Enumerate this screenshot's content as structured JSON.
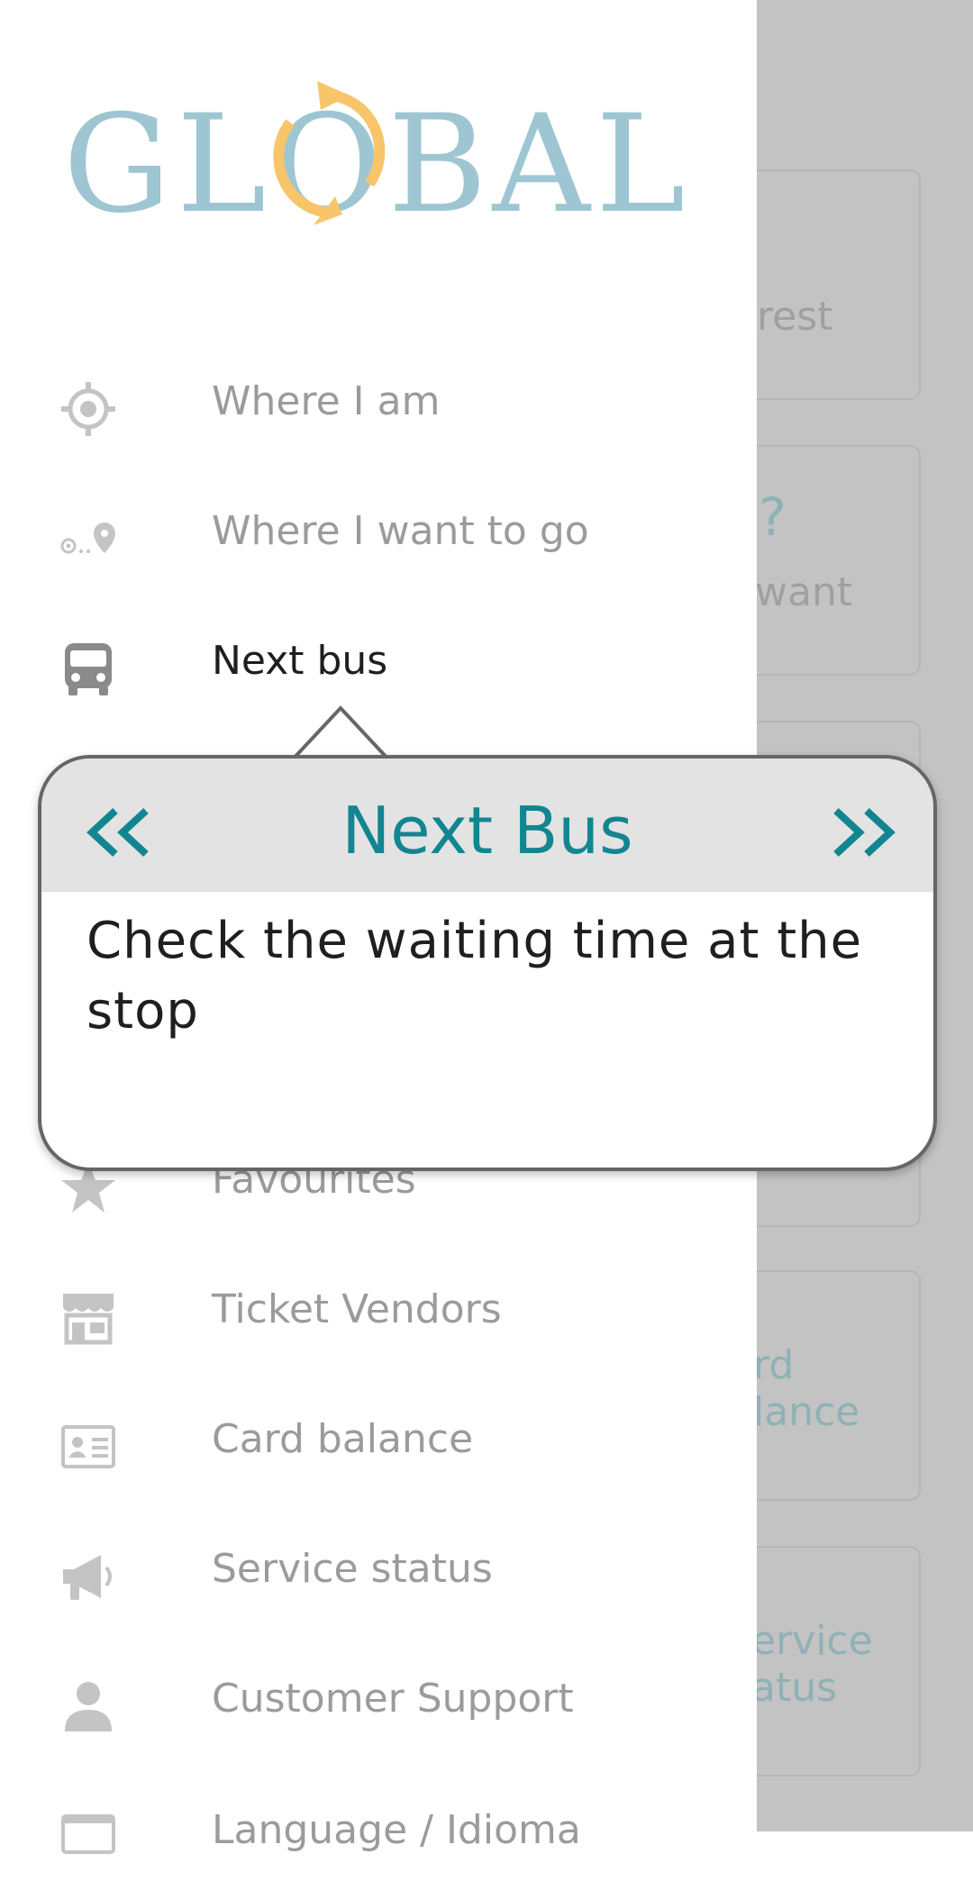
{
  "app": {
    "logo_text": "GLOBAL"
  },
  "colors": {
    "teal": "#128690",
    "logo_blue": "#9ec6d2",
    "logo_orange": "#f8c56a",
    "inactive": "#9b9b9b"
  },
  "background_cards": [
    {
      "lines": [
        "rest"
      ]
    },
    {
      "lines": [
        "?",
        "want"
      ]
    },
    {
      "lines": [
        ""
      ]
    },
    {
      "lines": [
        ""
      ]
    },
    {
      "lines": [
        "rd",
        "lance"
      ]
    },
    {
      "lines": [
        "ervice",
        "atus"
      ]
    }
  ],
  "menu": {
    "items": [
      {
        "label": "Where I am",
        "icon": "location-target-icon",
        "active": false
      },
      {
        "label": "Where I want to go",
        "icon": "route-pin-icon",
        "active": false
      },
      {
        "label": "Next bus",
        "icon": "bus-icon",
        "active": true
      },
      {
        "label": "Favourites",
        "icon": "star-icon",
        "active": false
      },
      {
        "label": "Ticket Vendors",
        "icon": "store-icon",
        "active": false
      },
      {
        "label": "Card balance",
        "icon": "id-card-icon",
        "active": false
      },
      {
        "label": "Service status",
        "icon": "megaphone-icon",
        "active": false
      },
      {
        "label": "Customer Support",
        "icon": "person-icon",
        "active": false
      },
      {
        "label": "Language / Idioma",
        "icon": "keyboard-icon",
        "active": false
      }
    ]
  },
  "tooltip": {
    "title": "Next Bus",
    "prev_label": "<<",
    "next_label": ">>",
    "text": "Check the waiting time at the stop"
  }
}
